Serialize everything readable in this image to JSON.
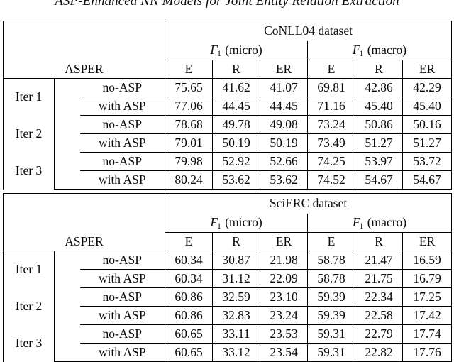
{
  "running_head": "ASP-Enhanced NN Models for Joint Entity Relation Extraction",
  "table": {
    "row_header_label": "ASPER",
    "metric_groups": [
      {
        "name": "micro",
        "label_prefix": "F",
        "label_sub": "1",
        "label_suffix": "(micro)"
      },
      {
        "name": "macro",
        "label_prefix": "F",
        "label_sub": "1",
        "label_suffix": "(macro)"
      }
    ],
    "metric_columns": [
      "E",
      "R",
      "ER",
      "E",
      "R",
      "ER"
    ],
    "blocks": [
      {
        "dataset": "CoNLL04 dataset",
        "micro_label": "(micro)",
        "macro_label": "(macro)",
        "groups": [
          {
            "iteration": "Iter 1",
            "rows": [
              {
                "variant": "no-ASP",
                "values": [
                  "75.65",
                  "41.62",
                  "41.07",
                  "69.81",
                  "42.86",
                  "42.29"
                ]
              },
              {
                "variant": "with ASP",
                "values": [
                  "77.06",
                  "44.45",
                  "44.45",
                  "71.16",
                  "45.40",
                  "45.40"
                ]
              }
            ]
          },
          {
            "iteration": "Iter 2",
            "rows": [
              {
                "variant": "no-ASP",
                "values": [
                  "78.68",
                  "49.78",
                  "49.08",
                  "73.24",
                  "50.86",
                  "50.16"
                ]
              },
              {
                "variant": "with ASP",
                "values": [
                  "79.01",
                  "50.19",
                  "50.19",
                  "73.49",
                  "51.27",
                  "51.27"
                ]
              }
            ]
          },
          {
            "iteration": "Iter 3",
            "rows": [
              {
                "variant": "no-ASP",
                "values": [
                  "79.98",
                  "52.92",
                  "52.66",
                  "74.25",
                  "53.97",
                  "53.72"
                ]
              },
              {
                "variant": "with ASP",
                "values": [
                  "80.24",
                  "53.62",
                  "53.62",
                  "74.52",
                  "54.67",
                  "54.67"
                ]
              }
            ]
          }
        ]
      },
      {
        "dataset": "SciERC dataset",
        "micro_label": "(micro)",
        "macro_label": "(macro)",
        "groups": [
          {
            "iteration": "Iter 1",
            "rows": [
              {
                "variant": "no-ASP",
                "values": [
                  "60.34",
                  "30.87",
                  "21.98",
                  "58.78",
                  "21.47",
                  "16.59"
                ]
              },
              {
                "variant": "with ASP",
                "values": [
                  "60.34",
                  "31.12",
                  "22.09",
                  "58.78",
                  "21.75",
                  "16.79"
                ]
              }
            ]
          },
          {
            "iteration": "Iter 2",
            "rows": [
              {
                "variant": "no-ASP",
                "values": [
                  "60.86",
                  "32.59",
                  "23.10",
                  "59.39",
                  "22.34",
                  "17.25"
                ]
              },
              {
                "variant": "with ASP",
                "values": [
                  "60.86",
                  "32.83",
                  "23.24",
                  "59.39",
                  "22.58",
                  "17.42"
                ]
              }
            ]
          },
          {
            "iteration": "Iter 3",
            "rows": [
              {
                "variant": "no-ASP",
                "values": [
                  "60.65",
                  "33.11",
                  "23.53",
                  "59.31",
                  "22.79",
                  "17.74"
                ]
              },
              {
                "variant": "with ASP",
                "values": [
                  "60.65",
                  "33.12",
                  "23.54",
                  "59.31",
                  "22.82",
                  "17.76"
                ]
              }
            ]
          }
        ]
      }
    ]
  }
}
